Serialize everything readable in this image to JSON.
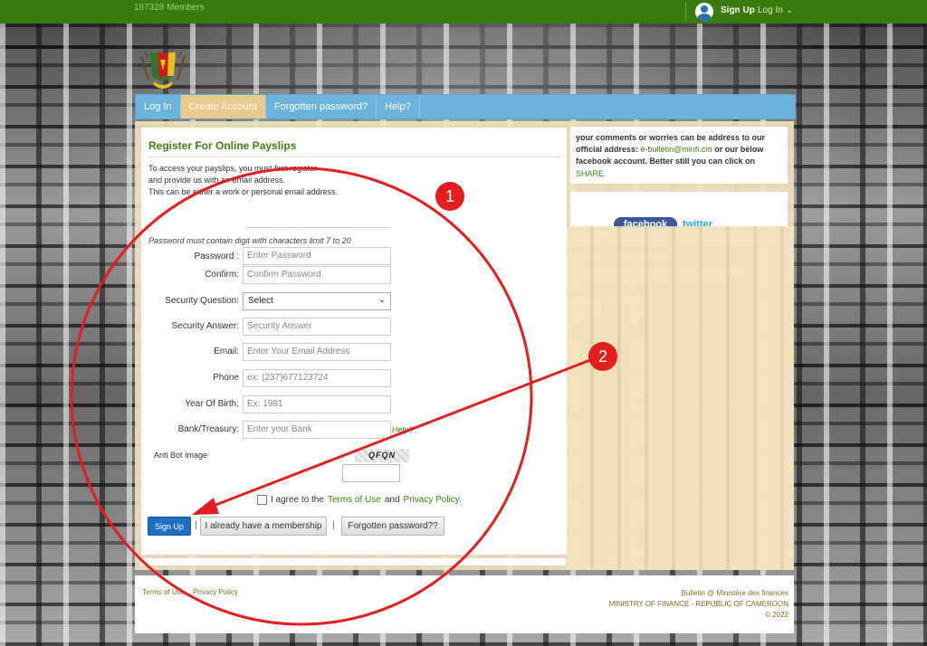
{
  "topbar": {
    "members": "187328 Members",
    "signup": "Sign Up",
    "login": "Log In"
  },
  "nav": {
    "items": [
      "Log In",
      "Create Account",
      "Forgotten password?",
      "Help?"
    ]
  },
  "form": {
    "title": "Register For Online Payslips",
    "intro": [
      "To access your payslips, you must first register",
      "and provide us with an email address.",
      "This can be either a work or personal email address."
    ],
    "password_hint": "Password must contain digit with characters limit 7 to 20",
    "password": {
      "label": "Password :",
      "placeholder": "Enter Password"
    },
    "confirm": {
      "label": "Confirm:",
      "placeholder": "Confirm Password"
    },
    "security_question": {
      "label": "Security Question:",
      "selected": "Select"
    },
    "security_answer": {
      "label": "Security Answer:",
      "placeholder": "Security Answer"
    },
    "email": {
      "label": "Email:",
      "placeholder": "Enter Your Email Address"
    },
    "phone": {
      "label": "Phone",
      "placeholder": "ex: (237)677123724"
    },
    "year_of_birth": {
      "label": "Year Of Birth:",
      "placeholder": "Ex: 1981"
    },
    "bank": {
      "label": "Bank/Treasury:",
      "placeholder": "Enter your Bank",
      "help": "Help?"
    },
    "antibot_label": "Anti Bot Image",
    "captcha_text": "QFQN",
    "agree_prefix": "I agree to the",
    "terms_link": "Terms of Use",
    "agree_and": "and",
    "privacy_link": "Privacy Policy.",
    "signup_button": "Sign Up",
    "membership_button": "I already have a membership",
    "forgot_button": "Forgotten password??",
    "separator": "|"
  },
  "right": {
    "text1": "your comments or worries can be address to our official address:",
    "email": "e-bulletin@minfi.cm",
    "text2": "or our below facebook account. Better still you can click on",
    "share": "SHARE",
    "facebook": "facebook",
    "twitter": "twitter"
  },
  "footer": {
    "terms": "Terms of Use",
    "privacy": "Privacy Policy",
    "line1": "Bulletin @ Ministère des finances",
    "line2": "MINISTRY OF FINANCE - REPUBLIC OF CAMEROON",
    "line3": "© 2022"
  },
  "annotations": {
    "badge1": "1",
    "badge2": "2",
    "color": "#e41e1e"
  },
  "colors": {
    "topbar": "#3b7a0f",
    "nav": "#6ab3dd",
    "nav_active": "#e8c98a",
    "accent_green": "#3f7f0d",
    "signup_button": "#1e6fc3"
  }
}
